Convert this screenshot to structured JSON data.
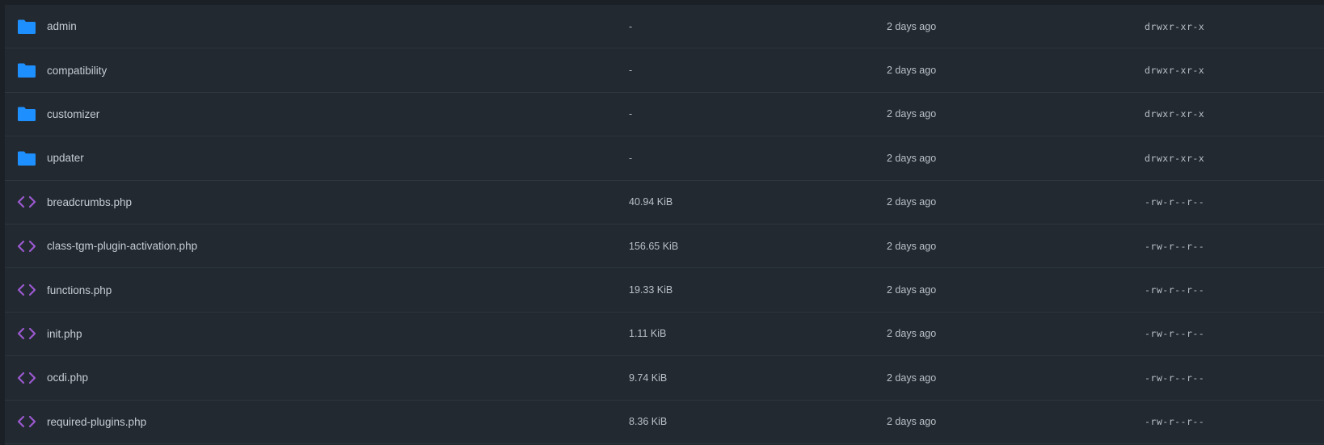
{
  "colors": {
    "folder_icon": "#1e8fff",
    "code_icon": "#9b59d0"
  },
  "files": [
    {
      "icon": "folder-icon",
      "name": "admin",
      "size": "-",
      "modified": "2 days ago",
      "perms": "drwxr-xr-x"
    },
    {
      "icon": "folder-icon",
      "name": "compatibility",
      "size": "-",
      "modified": "2 days ago",
      "perms": "drwxr-xr-x"
    },
    {
      "icon": "folder-icon",
      "name": "customizer",
      "size": "-",
      "modified": "2 days ago",
      "perms": "drwxr-xr-x"
    },
    {
      "icon": "folder-icon",
      "name": "updater",
      "size": "-",
      "modified": "2 days ago",
      "perms": "drwxr-xr-x"
    },
    {
      "icon": "code-icon",
      "name": "breadcrumbs.php",
      "size": "40.94 KiB",
      "modified": "2 days ago",
      "perms": "-rw-r--r--"
    },
    {
      "icon": "code-icon",
      "name": "class-tgm-plugin-activation.php",
      "size": "156.65 KiB",
      "modified": "2 days ago",
      "perms": "-rw-r--r--"
    },
    {
      "icon": "code-icon",
      "name": "functions.php",
      "size": "19.33 KiB",
      "modified": "2 days ago",
      "perms": "-rw-r--r--"
    },
    {
      "icon": "code-icon",
      "name": "init.php",
      "size": "1.11 KiB",
      "modified": "2 days ago",
      "perms": "-rw-r--r--"
    },
    {
      "icon": "code-icon",
      "name": "ocdi.php",
      "size": "9.74 KiB",
      "modified": "2 days ago",
      "perms": "-rw-r--r--"
    },
    {
      "icon": "code-icon",
      "name": "required-plugins.php",
      "size": "8.36 KiB",
      "modified": "2 days ago",
      "perms": "-rw-r--r--"
    }
  ]
}
